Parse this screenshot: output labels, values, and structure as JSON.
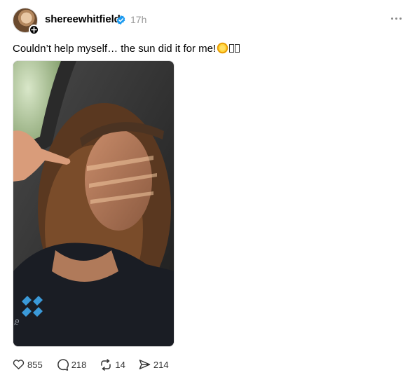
{
  "post": {
    "username": "shereewhitfield",
    "time_ago": "17h",
    "caption": "Couldn’t help myself… the sun did it for me!",
    "photo_badge_text": "TD"
  },
  "stats": {
    "likes": "855",
    "comments": "218",
    "reposts": "14",
    "shares": "214"
  },
  "icons": {
    "verified": "verified-badge-icon",
    "follow": "plus-icon",
    "more": "more-horizontal-icon",
    "like": "heart-icon",
    "comment": "speech-bubble-icon",
    "repost": "repost-arrows-icon",
    "share": "paper-plane-icon",
    "caption_emoji": "sun-emoji-icon"
  },
  "colors": {
    "verified_blue": "#1d9bf0",
    "timestamp_gray": "#999999"
  }
}
